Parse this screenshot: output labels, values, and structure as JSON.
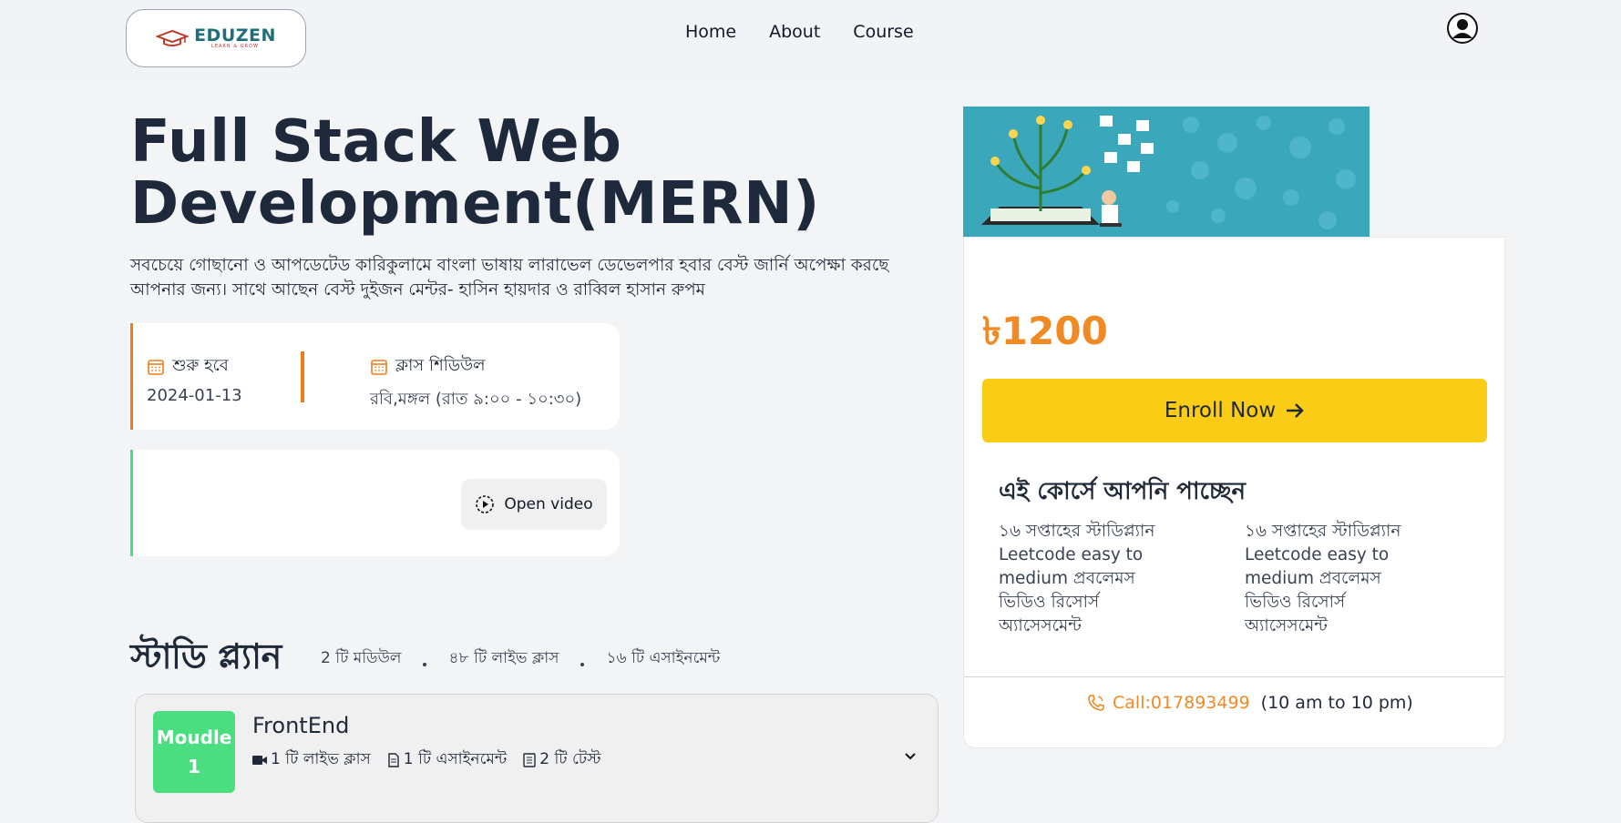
{
  "nav": {
    "logo_text": "EDUZEN",
    "logo_tagline": "LEARN & GROW",
    "links": [
      "Home",
      "About",
      "Course"
    ]
  },
  "course": {
    "title_line1": "Full Stack Web",
    "title_line2": "Development(MERN)",
    "description": "সবচেয়ে গোছানো ও আপডেটেড কারিকুলামে বাংলা ভাষায় লারাভেল ডেভেলপার হবার বেস্ট জার্নি অপেক্ষা করছে আপনার জন্য। সাথে আছেন বেস্ট দুইজন মেন্টর- হাসিন হায়দার ও রাব্বিল হাসান রুপম",
    "start_label": "শুরু হবে",
    "start_date": "2024-01-13",
    "schedule_label": "ক্লাস শিডিউল",
    "schedule_value": "রবি,মঙ্গল (রাত ৯:০০ - ১০:৩০)",
    "video_button": "Open video"
  },
  "study_plan": {
    "title": "স্টাডি প্ল্যান",
    "stats": [
      "2 টি মডিউল",
      "৪৮ টি লাইভ ক্লাস",
      "১৬ টি এসাইনমেন্ট"
    ],
    "modules": [
      {
        "badge_line1": "Moudle",
        "badge_line2": "1",
        "title": "FrontEnd",
        "live": "1 টি লাইভ ক্লাস",
        "assignment": "1 টি এসাইনমেন্ট",
        "test": "2 টি টেস্ট"
      }
    ]
  },
  "sidebar": {
    "price": "৳1200",
    "enroll_label": "Enroll Now",
    "get_title": "এই কোর্সে আপনি পাচ্ছেন",
    "features_left": [
      "১৬ সপ্তাহের স্টাডিপ্ল্যান",
      "Leetcode easy to medium প্রবলেমস",
      "ভিডিও রিসোর্স",
      "অ্যাসেসমেন্ট"
    ],
    "features_right": [
      "১৬ সপ্তাহের স্টাডিপ্ল্যান",
      "Leetcode easy to medium প্রবলেমস",
      "ভিডিও রিসোর্স",
      "অ্যাসেসমেন্ট"
    ],
    "call_number": "Call:017893499",
    "call_hours": "(10 am to 10 pm)"
  },
  "colors": {
    "accent_orange": "#f08a24",
    "enroll_yellow": "#facc15",
    "module_green": "#4ade80"
  }
}
